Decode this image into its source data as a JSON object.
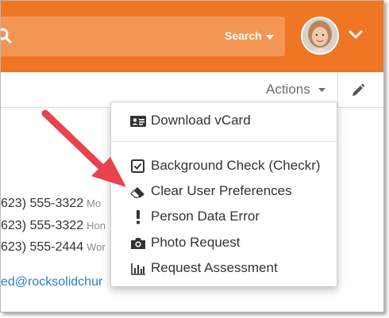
{
  "header": {
    "search_label": "Search",
    "accent_color": "#ee7624"
  },
  "toolbar": {
    "actions_label": "Actions"
  },
  "contact": {
    "phones": [
      {
        "number": "623) 555-3322",
        "type": "Mo"
      },
      {
        "number": "623) 555-3322",
        "type": "Hon"
      },
      {
        "number": "623) 555-2444",
        "type": "Wor"
      }
    ],
    "email": "ed@rocksolidchur"
  },
  "actions_menu": {
    "items": [
      {
        "label": "Download vCard",
        "icon": "vcard-icon"
      },
      {
        "label": "Background Check (Checkr)",
        "icon": "checkbox-icon"
      },
      {
        "label": "Clear User Preferences",
        "icon": "eraser-icon"
      },
      {
        "label": "Person Data Error",
        "icon": "exclamation-icon"
      },
      {
        "label": "Photo Request",
        "icon": "camera-icon"
      },
      {
        "label": "Request Assessment",
        "icon": "bar-chart-icon"
      }
    ]
  },
  "annotation": {
    "arrow_color": "#e8434e"
  }
}
